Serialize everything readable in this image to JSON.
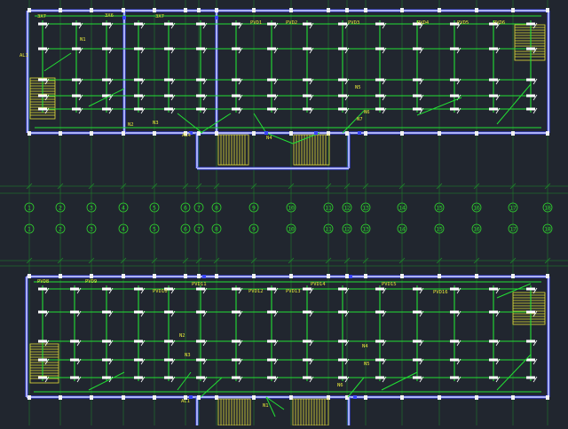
{
  "drawing": {
    "colors": {
      "background": "#21262f",
      "wire": "#22e034",
      "wall": "#f2f2f2",
      "wall_edge": "#3a46ff",
      "grid": "#1f8a2a",
      "label": "#e8e83a",
      "fixture": "#ffffff",
      "stair": "#e6e23a",
      "circle": "#2fd12f"
    },
    "axis_labels": [
      "1",
      "2",
      "3",
      "4",
      "5",
      "6",
      "7",
      "8",
      "9",
      "10",
      "11",
      "12",
      "13",
      "14",
      "15",
      "16",
      "17",
      "18"
    ],
    "upper_plan": {
      "labels": [
        "3X7",
        "3X6",
        "3X7",
        "PVD1",
        "PVD2",
        "PVD3",
        "PVD4",
        "PVD5",
        "PVD6",
        "AL1",
        "AL4",
        "N1",
        "N2",
        "N3",
        "N4",
        "N5",
        "N6",
        "N7"
      ]
    },
    "lower_plan": {
      "labels": [
        "PVD8",
        "PVD9",
        "PVD10",
        "PVD11",
        "PVD12",
        "PVD13",
        "PVD14",
        "PVD15",
        "PVD16",
        "AL1",
        "N1",
        "N2",
        "N3",
        "N4",
        "N5",
        "N6"
      ]
    }
  }
}
